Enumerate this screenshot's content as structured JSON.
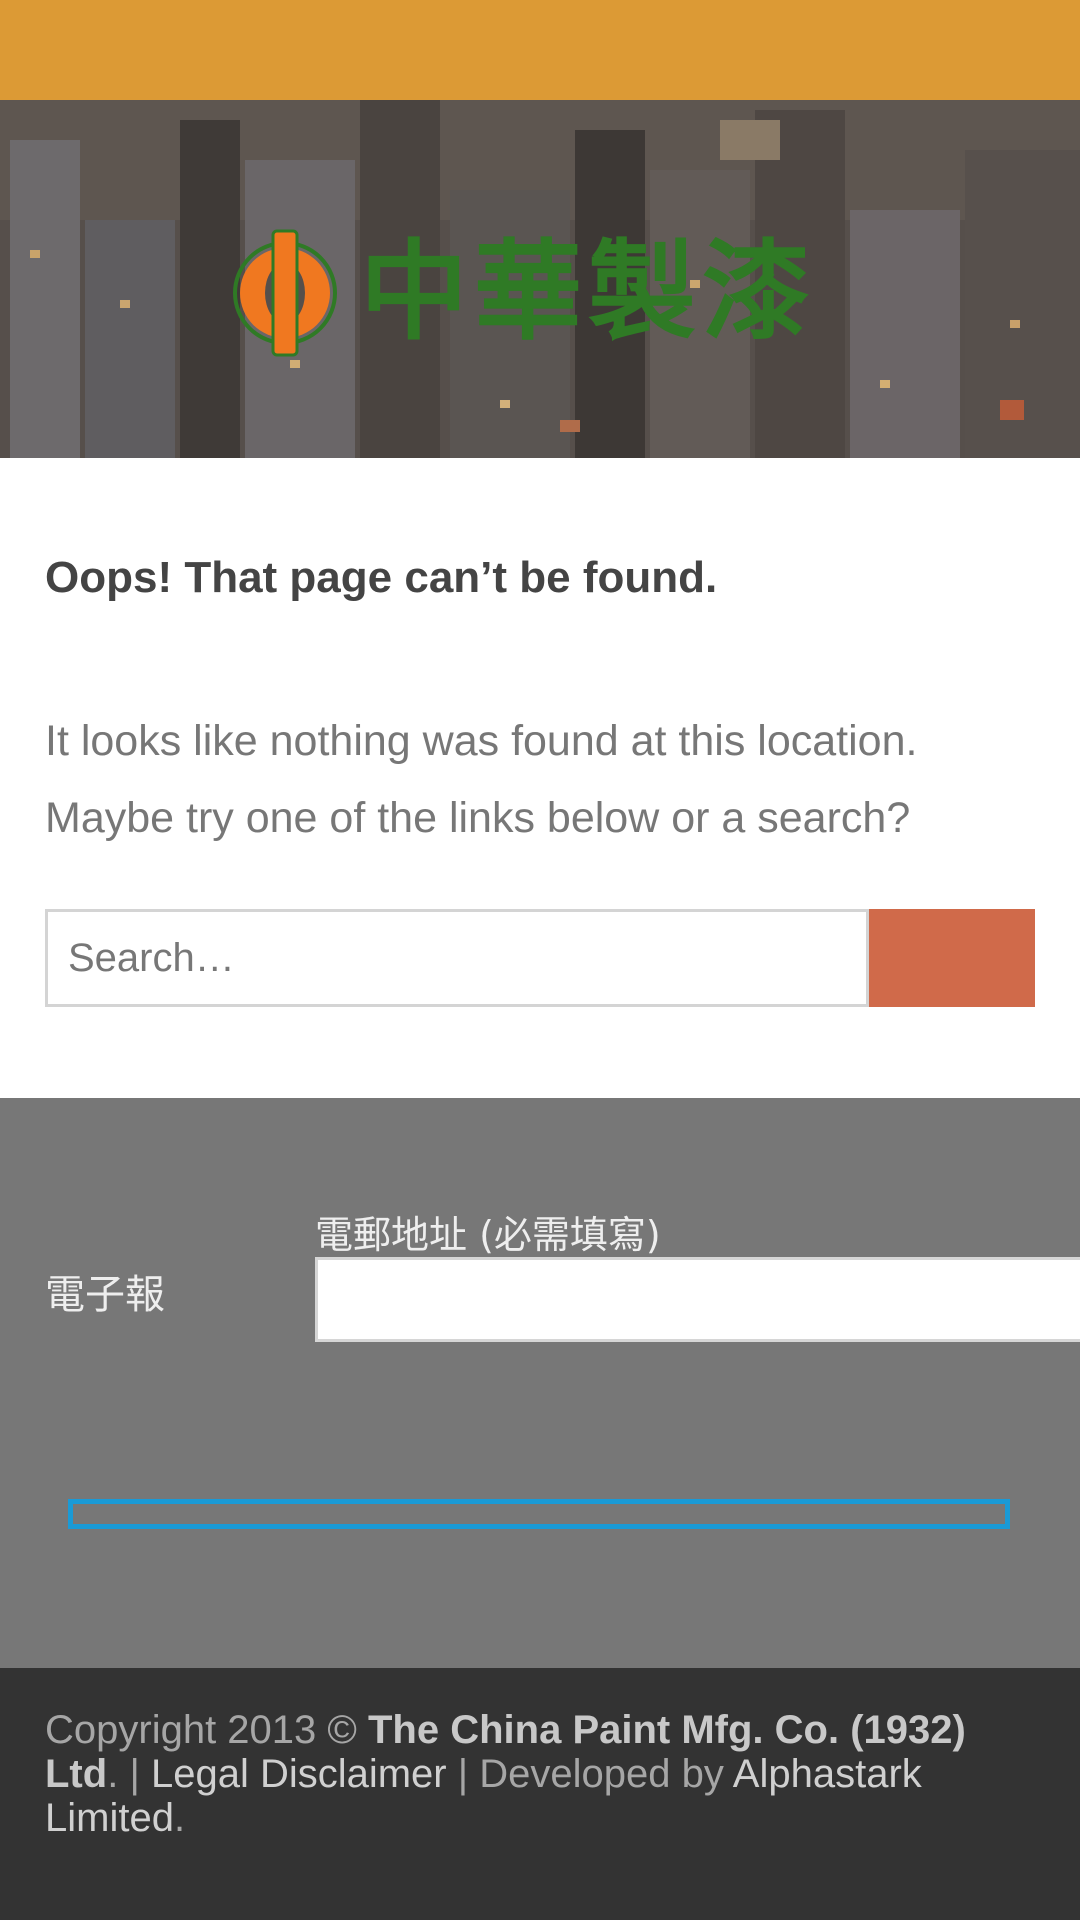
{
  "brand": {
    "logo_text": "中華製漆",
    "top_bar_color": "#dc9a35",
    "logo_green": "#2f7a25",
    "logo_orange": "#f07820"
  },
  "error_page": {
    "title": "Oops! That page can’t be found.",
    "message": "It looks like nothing was found at this location. Maybe try one of the links below or a search?"
  },
  "search": {
    "placeholder": "Search…",
    "value": "",
    "button_color": "#d06a4a"
  },
  "newsletter": {
    "title": "電子報",
    "email_label": "電郵地址 (必需填寫)",
    "email_value": "",
    "button_border_color": "#1a9ad6"
  },
  "footer": {
    "copyright_prefix": "Copyright 2013 ©",
    "company": "The China Paint Mfg. Co. (1932) Ltd",
    "company_suffix": ".",
    "separator1": "|",
    "legal_link": "Legal Disclaimer",
    "separator2": "|",
    "developed_by": "Developed by",
    "developer": "Alphastark Limited",
    "end": "."
  }
}
